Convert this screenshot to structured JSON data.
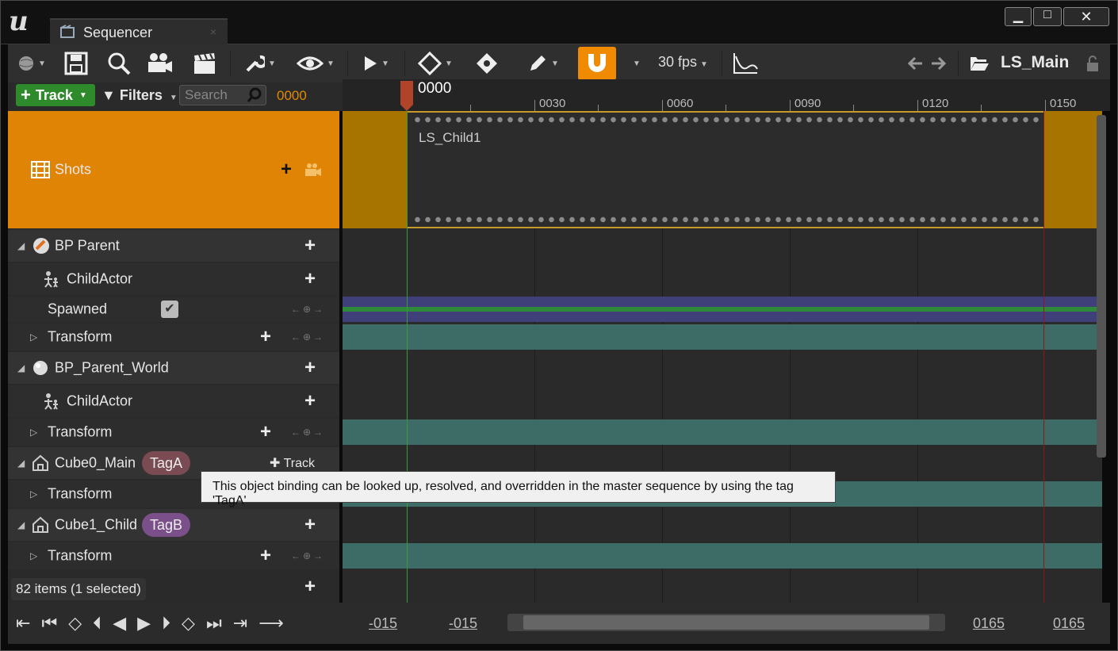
{
  "window": {
    "tab_title": "Sequencer",
    "tab_close": "×",
    "minimize": "▁",
    "maximize": "□",
    "close": "✕"
  },
  "toolbar": {
    "fps": "30 fps",
    "sequence_name": "LS_Main"
  },
  "tree_toolbar": {
    "add_track": "Track",
    "filters": "Filters",
    "search_placeholder": "Search Tracks",
    "current_frame": "0000"
  },
  "ruler": {
    "playhead_label": "0000",
    "ticks": [
      "0030",
      "0060",
      "0090",
      "0120",
      "0150"
    ]
  },
  "tree": {
    "shots": {
      "label": "Shots"
    },
    "bp_parent": {
      "label": "BP Parent"
    },
    "bp_parent_child": {
      "label": "ChildActor"
    },
    "spawned": {
      "label": "Spawned"
    },
    "bp_parent_transform": {
      "label": "Transform"
    },
    "bp_parent_world": {
      "label": "BP_Parent_World"
    },
    "bp_parent_world_child": {
      "label": "ChildActor"
    },
    "bp_parent_world_transform": {
      "label": "Transform"
    },
    "cube0": {
      "label": "Cube0_Main",
      "tag": "TagA",
      "track_btn": "Track"
    },
    "cube0_transform": {
      "label": "Transform"
    },
    "cube1": {
      "label": "Cube1_Child",
      "tag": "TagB"
    },
    "cube1_transform": {
      "label": "Transform"
    }
  },
  "shot_section": {
    "label": "LS_Child1"
  },
  "tooltip": "This object binding can be looked up, resolved, and overridden in the master sequence by using the tag 'TagA'",
  "status": "82 items (1 selected)",
  "playback_range": {
    "view_start": "-015",
    "work_start": "-015",
    "work_end": "0165",
    "view_end": "0165"
  },
  "colors": {
    "accent_orange": "#e08406",
    "add_track_green": "#2f8a2b",
    "tag_a": "#7a4b52",
    "tag_b": "#7a4f8a",
    "transform_lane": "#3d6b66",
    "spawned_lane": "#3f3f7a"
  }
}
